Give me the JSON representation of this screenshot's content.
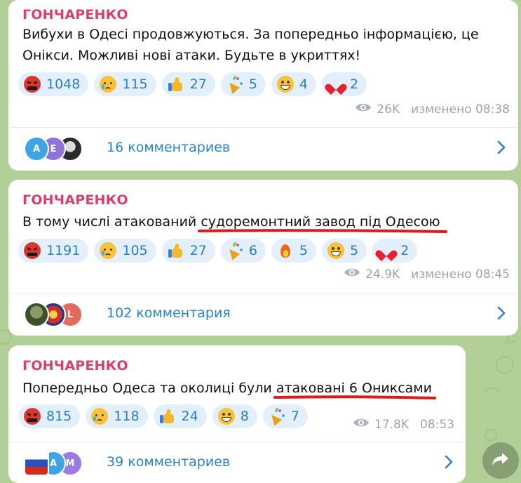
{
  "posts": [
    {
      "author": "ГОНЧАРЕНКО",
      "text_before": "Вибухи в Одесі продовжуються. За попередньо інформацією, це Онікси. Можливі нові атаки. Будьте в укриттях!",
      "text_underlined": "",
      "text_after": "",
      "reactions": [
        {
          "icon": "angry-face-icon",
          "count": "1048"
        },
        {
          "icon": "crying-face-icon",
          "count": "115"
        },
        {
          "icon": "thumbs-up-icon",
          "count": "27"
        },
        {
          "icon": "party-popper-icon",
          "count": "5"
        },
        {
          "icon": "grinning-face-icon",
          "count": "4"
        },
        {
          "icon": "red-heart-icon",
          "count": "2"
        }
      ],
      "views": "26K",
      "time": "изменено 08:38",
      "avatars": [
        {
          "letter": "A",
          "color": "#3ea4e6"
        },
        {
          "letter": "E",
          "color": "#8e74d8"
        },
        {
          "letter": "",
          "color": "#2a2a2a"
        }
      ],
      "comments": "16 комментариев"
    },
    {
      "author": "ГОНЧАРЕНКО",
      "text_before": "В тому числі атакований ",
      "text_underlined": "судоремонтний завод під Одесою",
      "text_after": "",
      "reactions": [
        {
          "icon": "angry-face-icon",
          "count": "1191"
        },
        {
          "icon": "crying-face-icon",
          "count": "105"
        },
        {
          "icon": "thumbs-up-icon",
          "count": "27"
        },
        {
          "icon": "party-popper-icon",
          "count": "6"
        },
        {
          "icon": "fire-icon",
          "count": "5"
        },
        {
          "icon": "grinning-face-icon",
          "count": "5"
        },
        {
          "icon": "red-heart-icon",
          "count": "2"
        }
      ],
      "views": "24.9K",
      "time": "изменено 08:45",
      "avatars": [
        {
          "letter": "",
          "color": "#556b3a"
        },
        {
          "letter": "",
          "color": "#c8312e"
        },
        {
          "letter": "L",
          "color": "#e36a5c"
        }
      ],
      "comments": "102 комментария"
    },
    {
      "author": "ГОНЧАРЕНКО",
      "text_before": "Попередньо Одеса та околиці були ",
      "text_underlined": "атаковані 6 Ониксами",
      "text_after": "",
      "reactions": [
        {
          "icon": "angry-face-icon",
          "count": "815"
        },
        {
          "icon": "crying-face-icon",
          "count": "118"
        },
        {
          "icon": "thumbs-up-icon",
          "count": "24"
        },
        {
          "icon": "grinning-face-icon",
          "count": "8"
        },
        {
          "icon": "party-popper-icon",
          "count": "7"
        }
      ],
      "views": "17.8K",
      "time": "08:53",
      "avatars": [
        {
          "letter": "",
          "color": "#ffffff"
        },
        {
          "letter": "A",
          "color": "#3ea4e6"
        },
        {
          "letter": "M",
          "color": "#9a7be0"
        }
      ],
      "comments": "39 комментариев"
    }
  ],
  "colors": {
    "author": "#dc3e6e",
    "accent": "#2b82c8",
    "reaction_bg": "#e3f0fb",
    "underline": "#d81b1b",
    "wallpaper": "#b3cf98"
  }
}
